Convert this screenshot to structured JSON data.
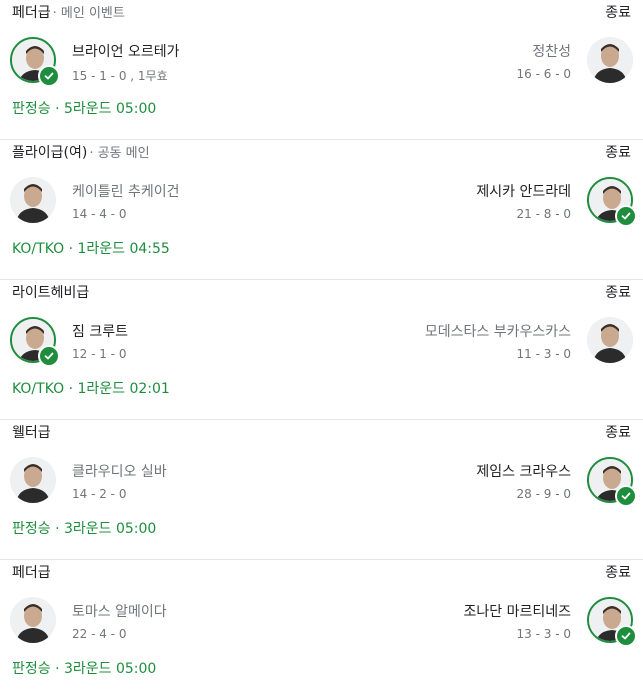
{
  "fights": [
    {
      "division": "페더급",
      "subtitle": "· 메인 이벤트",
      "status": "종료",
      "left": {
        "name": "브라이언 오르테가",
        "record": "15 - 1 - 0 , 1무효",
        "winner": true
      },
      "right": {
        "name": "정찬성",
        "record": "16 - 6 - 0",
        "winner": false
      },
      "result": "판정승 · 5라운드 05:00"
    },
    {
      "division": "플라이급(여)",
      "subtitle": "· 공동 메인",
      "status": "종료",
      "left": {
        "name": "케이틀린 추케이건",
        "record": "14 - 4 - 0",
        "winner": false
      },
      "right": {
        "name": "제시카 안드라데",
        "record": "21 - 8 - 0",
        "winner": true
      },
      "result": "KO/TKO · 1라운드 04:55"
    },
    {
      "division": "라이트헤비급",
      "subtitle": "",
      "status": "종료",
      "left": {
        "name": "짐 크루트",
        "record": "12 - 1 - 0",
        "winner": true
      },
      "right": {
        "name": "모데스타스 부카우스카스",
        "record": "11 - 3 - 0",
        "winner": false
      },
      "result": "KO/TKO · 1라운드 02:01"
    },
    {
      "division": "웰터급",
      "subtitle": "",
      "status": "종료",
      "left": {
        "name": "클라우디오 실바",
        "record": "14 - 2 - 0",
        "winner": false
      },
      "right": {
        "name": "제임스 크라우스",
        "record": "28 - 9 - 0",
        "winner": true
      },
      "result": "판정승 · 3라운드 05:00"
    },
    {
      "division": "페더급",
      "subtitle": "",
      "status": "종료",
      "left": {
        "name": "토마스 알메이다",
        "record": "22 - 4 - 0",
        "winner": false
      },
      "right": {
        "name": "조나단 마르티네즈",
        "record": "13 - 3 - 0",
        "winner": true
      },
      "result": "판정승 · 3라운드 05:00"
    }
  ],
  "colors": {
    "accent": "#1e8e3e",
    "secondary_text": "#70757a",
    "primary_text": "#202124"
  },
  "icons": {
    "avatar": "fighter-avatar-icon",
    "check": "check-icon"
  }
}
